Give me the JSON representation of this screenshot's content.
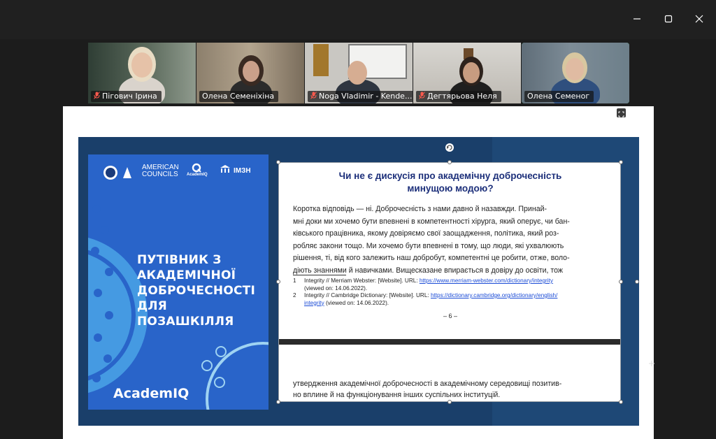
{
  "window": {
    "controls": [
      "minimize-icon",
      "maximize-icon",
      "close-icon"
    ],
    "close_glyph": "✕"
  },
  "participants": [
    {
      "name": "Пігович Ірина",
      "muted": true
    },
    {
      "name": "Олена Семеніхіна",
      "muted": false
    },
    {
      "name": "Noga Vladimir - Kende...",
      "muted": true
    },
    {
      "name": "Дегтярьова Неля",
      "muted": true
    },
    {
      "name": "Олена Семеног",
      "muted": false,
      "speaking": true
    }
  ],
  "slide": {
    "cover": {
      "logo_text_1": "AMERICAN",
      "logo_text_2": "COUNCILS",
      "logo_small": "AcademIQ",
      "logo_right": "ІМЗН",
      "title_lines": [
        "ПУТІВНИК З",
        "АКАДЕМІЧНОЇ",
        "ДОБРОЧЕСНОСТІ",
        "ДЛЯ ПОЗАШКІЛЛЯ"
      ],
      "brand": "AcademIQ"
    },
    "page": {
      "heading_line1": "Чи не є дискусія про академічну доброчесність",
      "heading_line2": "минущою модою?",
      "paragraph_lines": [
        "     Коротка відповідь — ні. Доброчесність з нами давно й назавжди. Принай-",
        "мні доки ми хочемо бути впевнені в компетентності хірурга, який оперує, чи бан-",
        "ківського працівника, якому довіряємо свої заощадження, політика, який роз-",
        "робляє закони тощо. Ми хочемо бути впевнені в тому, що люди, які ухвалюють",
        "рішення, ті, від кого залежить наш добробут, компетентні це робити, отже, воло-",
        "діють знаннями й навичками. Вищесказане впирається в довіру до освіти, тож"
      ],
      "footnote1_num": "1",
      "footnote1_text": "Integrity // Merriam Webster: [Website]. URL: ",
      "footnote1_link": "https://www.merriam-webster.com/dictionary/integrity",
      "footnote1_tail": "(viewed on: 14.06.2022).",
      "footnote2_num": "2",
      "footnote2_text": "Integrity // Cambridge Dictionary: [Website]. URL: ",
      "footnote2_link": "https://dictionary.cambridge.org/dictionary/english/",
      "footnote2_link2": "integrity",
      "footnote2_tail": " (viewed on: 14.06.2022).",
      "page_number": "– 6 –",
      "tail_lines": [
        "утвердження академічної доброчесності в академічному середовищі позитив-",
        "но вплине й на функціонування інших суспільних інституцій."
      ]
    }
  },
  "colors": {
    "speaking_border": "#3ddc84",
    "cover_blue": "#2964c9",
    "heading_blue": "#1c2f7a",
    "link_blue": "#1a4bd6"
  }
}
